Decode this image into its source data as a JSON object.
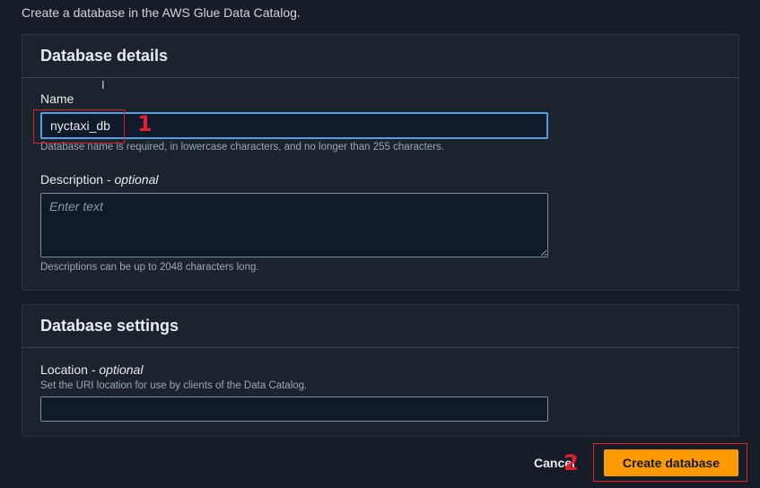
{
  "intro_text": "Create a database in the AWS Glue Data Catalog.",
  "details_panel": {
    "title": "Database details",
    "name": {
      "label": "Name",
      "value": "nyctaxi_db",
      "hint": "Database name is required, in lowercase characters, and no longer than 255 characters."
    },
    "description": {
      "label": "Description",
      "optional_label": "optional",
      "separator": " - ",
      "placeholder": "Enter text",
      "hint": "Descriptions can be up to 2048 characters long."
    }
  },
  "settings_panel": {
    "title": "Database settings",
    "location": {
      "label": "Location",
      "optional_label": "optional",
      "separator": " - ",
      "hint": "Set the URI location for use by clients of the Data Catalog.",
      "value": ""
    }
  },
  "actions": {
    "cancel_label": "Cancel",
    "create_label": "Create database"
  },
  "annotations": {
    "marker_1": "1",
    "marker_2": "2",
    "color": "#e0202a"
  },
  "colors": {
    "accent": "#ff9900",
    "focus": "#539fe5"
  }
}
